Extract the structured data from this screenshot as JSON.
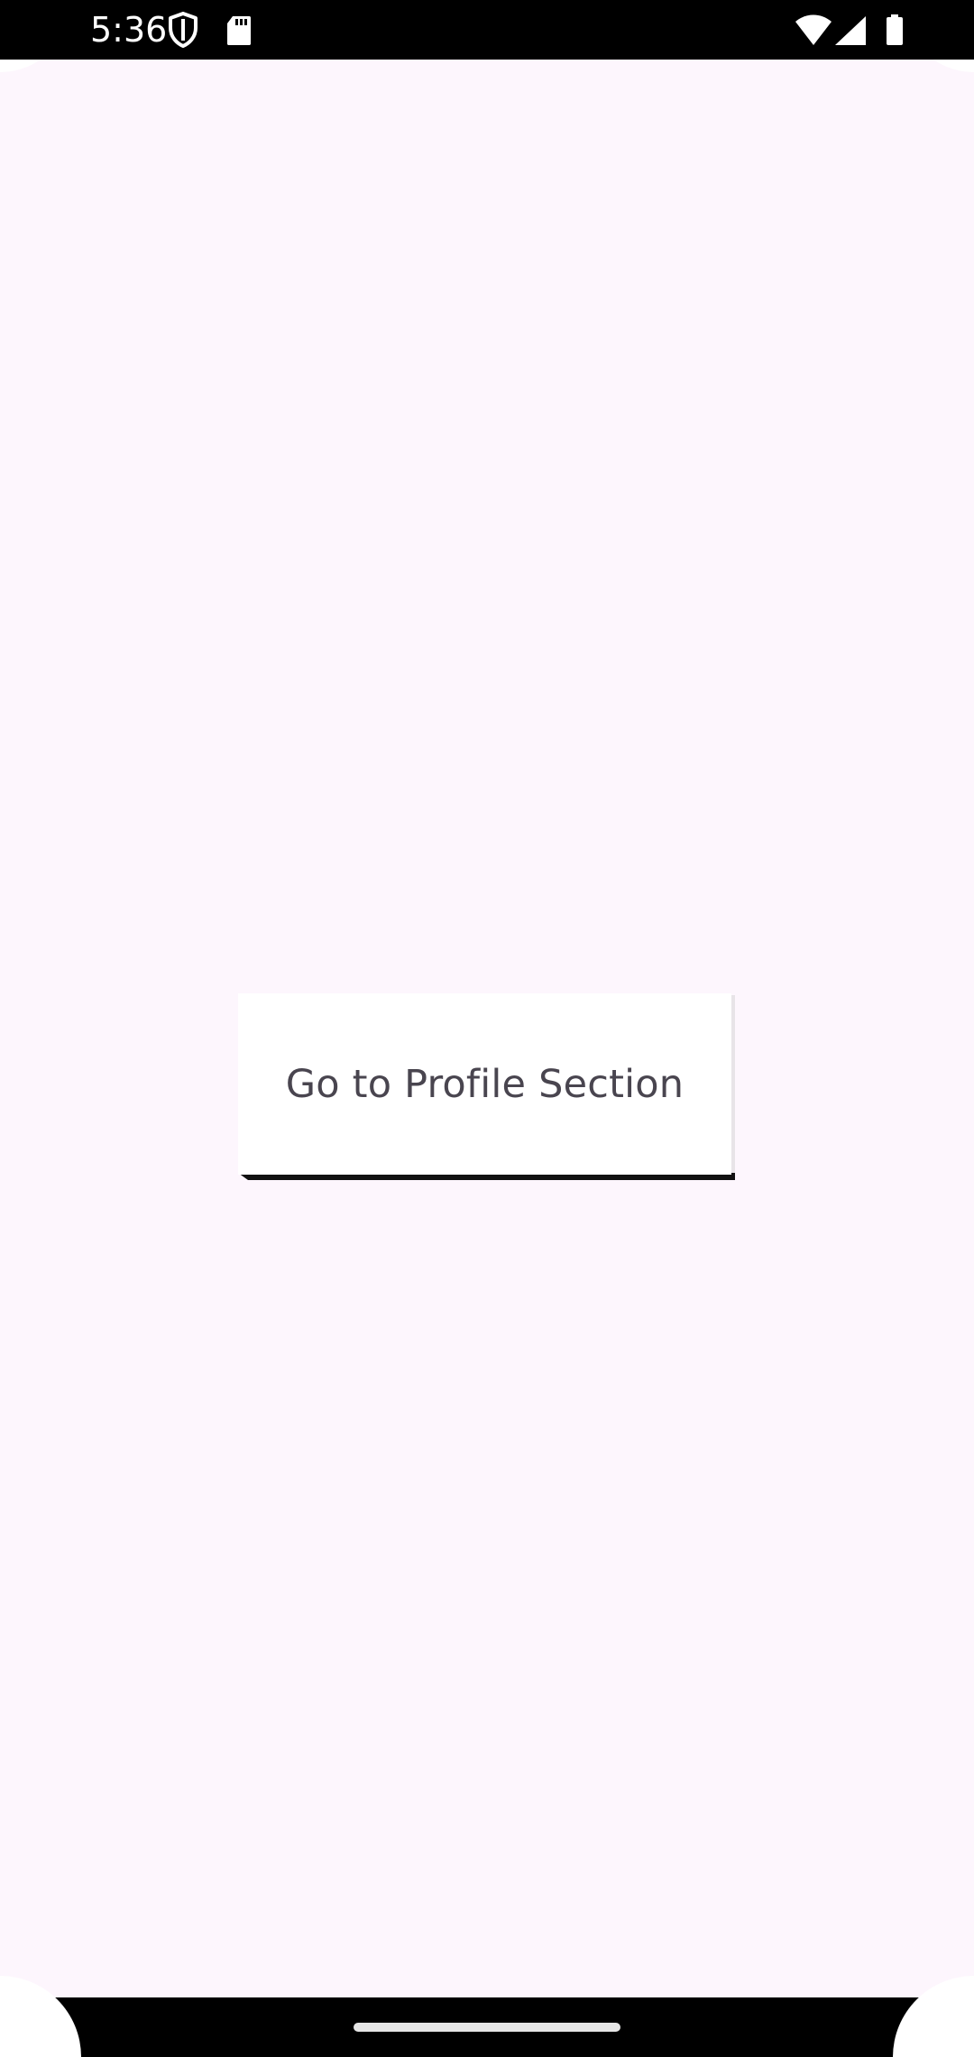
{
  "status_bar": {
    "time": "5:36",
    "icons": {
      "left": [
        "shield-icon",
        "sd-card-icon"
      ],
      "right": [
        "wifi-icon",
        "signal-icon",
        "battery-icon"
      ]
    }
  },
  "main": {
    "profile_button_label": "Go to Profile Section"
  },
  "colors": {
    "background": "#fdf6fd",
    "button_background": "#ffffff",
    "button_text": "#49454f",
    "status_bar": "#000000"
  }
}
